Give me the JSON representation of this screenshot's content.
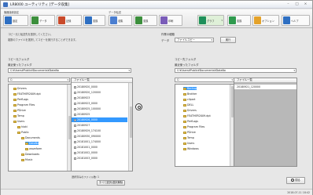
{
  "window": {
    "title": "LR8000 ユーティリティ [データ収集]"
  },
  "toolbar": {
    "group1_label": "機器接続設定",
    "group2_label": "データ転送",
    "buttons": [
      {
        "label": "設定",
        "color": "#2e6fc2"
      },
      {
        "label": "データ",
        "color": "#3c8f3c"
      },
      {
        "label": "記録",
        "color": "#c94a2a"
      },
      {
        "label": "変換",
        "color": "#2e6fc2"
      },
      {
        "label": "収集",
        "color": "#4a7ed0"
      },
      {
        "label": "変換",
        "color": "#3c8f3c"
      },
      {
        "label": "印刷",
        "color": "#7a5cb8"
      },
      {
        "label": "グラフ",
        "color": "#1e8f5a"
      },
      {
        "label": "変換",
        "color": "#2f9a4e"
      },
      {
        "label": "オプション",
        "color": "#e4a22a"
      },
      {
        "label": "ヘルプ",
        "color": "#2e6fc2"
      }
    ]
  },
  "hints": [
    "コピー元と転送先を選択してください。",
    "複数のファイルを選択してコピーを実行することができます。"
  ],
  "kind": {
    "label": "作業の種類",
    "value": "データ",
    "select_value": "ファイルコピー",
    "exec_label": "実行"
  },
  "left": {
    "title": "コピー元フォルダ",
    "sub": "最近使ったフォルダ",
    "path": "C:¥Users¥Public¥Documents¥DataNo",
    "drive": "C:",
    "filelist_header": "ファイル一覧",
    "tree": [
      "Drivers",
      "FEATHER2009.dpt",
      "PerfLogs",
      "Program Files",
      "PDrive",
      "Temp",
      "Users",
      "hioki",
      "Public",
      "Documents",
      "DataNo",
      "waveform",
      "Downloads",
      "Music"
    ],
    "files": [
      "20180920_0000",
      "20180920_120000",
      "20180923",
      "20180923_0000",
      "20180925_100000",
      "20180925",
      "20180926_0000",
      "20180927",
      "20180929_174100",
      "20180930_090000",
      "20181001_174000",
      "20181001_0000",
      "20181002_0000",
      "20181003_0000"
    ],
    "footer": "選択済みのファイル数: 1",
    "select_all_label": "すべて選択/選択解除"
  },
  "right": {
    "title": "コピー先フォルダ",
    "sub": "最近使ったフォルダ",
    "path": "C:¥Users¥Public¥Documents¥DataNo",
    "drive": "C:",
    "filelist_header": "ファイル一覧",
    "tree": [
      "Backup",
      "Brother",
      "clipart",
      "DELL",
      "Drivers",
      "FEATHER2009.dpt",
      "PerfLogs",
      "Program Files",
      "PDrive",
      "Temp",
      "Users",
      "Windows"
    ],
    "files": [
      "20180921_120000"
    ],
    "close_label": "閉る"
  },
  "status": {
    "clock": "2018-07-11 18:42"
  }
}
